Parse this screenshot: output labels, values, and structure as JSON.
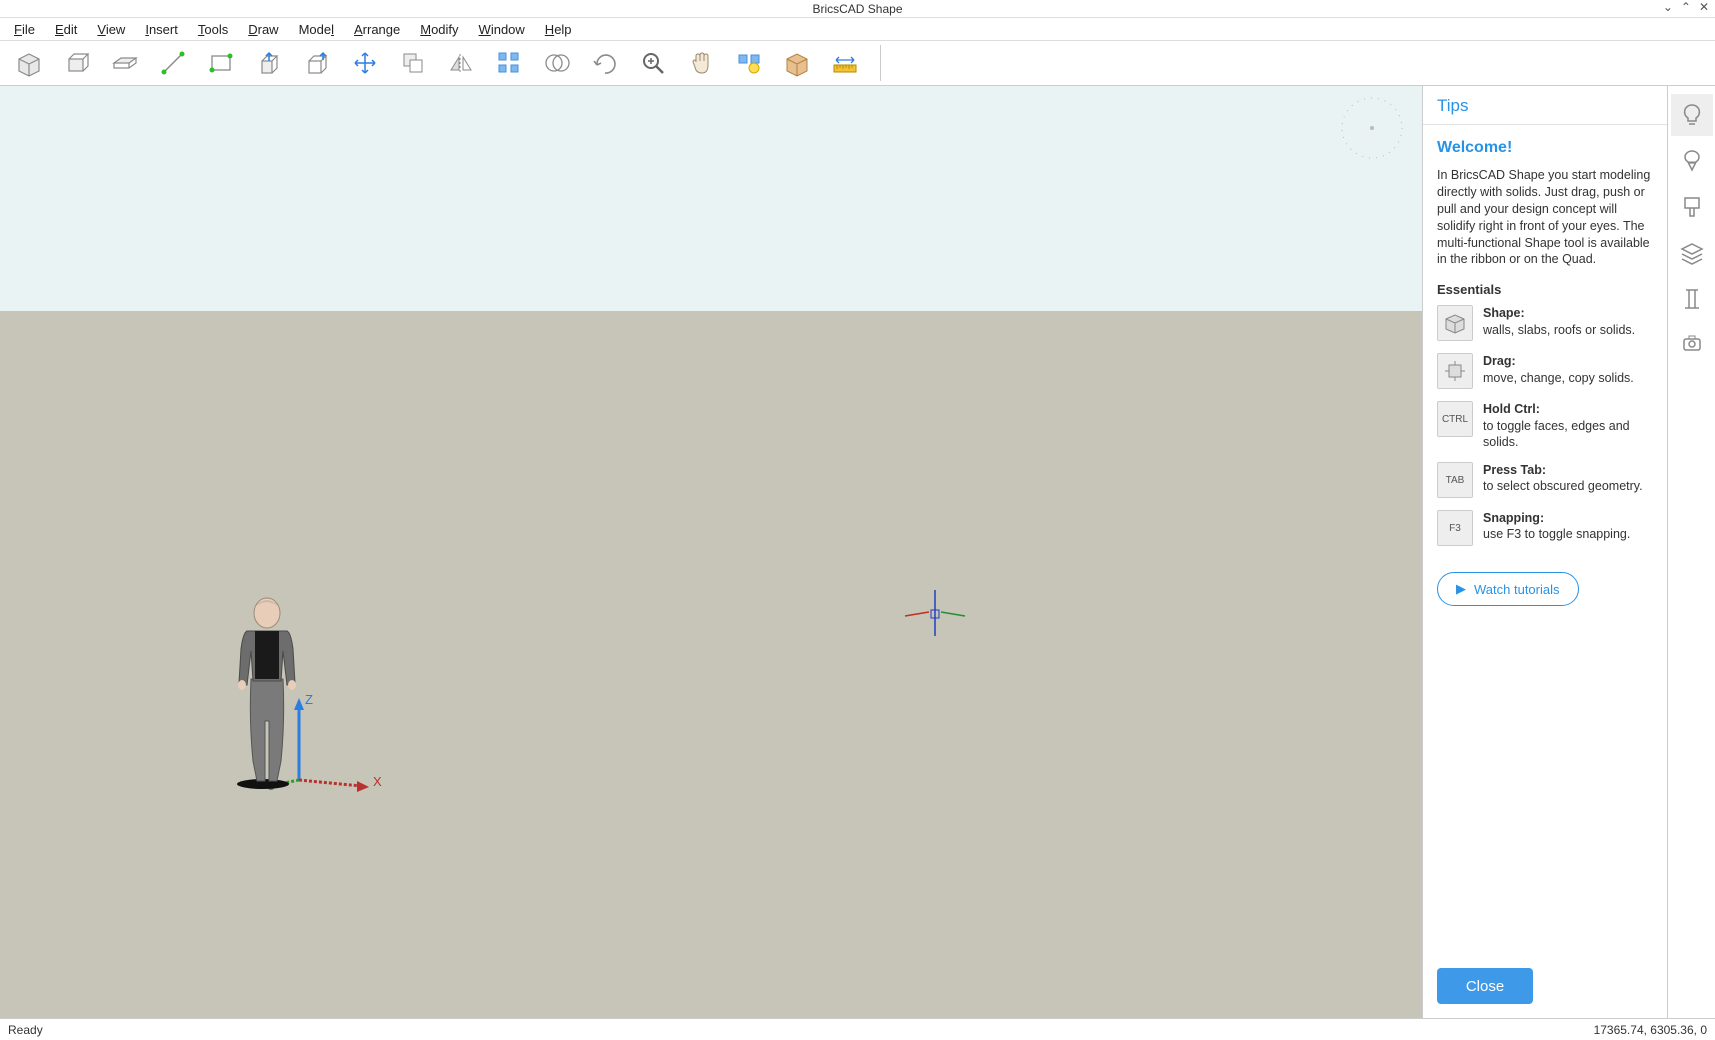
{
  "window": {
    "title": "BricsCAD Shape"
  },
  "menus": [
    "File",
    "Edit",
    "View",
    "Insert",
    "Tools",
    "Draw",
    "Model",
    "Arrange",
    "Modify",
    "Window",
    "Help"
  ],
  "toolbar_names": [
    "shape-tool",
    "box-tool",
    "slab-tool",
    "line-tool",
    "rect-tool",
    "pushpull-tool",
    "extrude-tool",
    "move-tool",
    "copy-tool",
    "mirror-tool",
    "array-tool",
    "boolean-tool",
    "rotate-tool",
    "zoom-tool",
    "pan-tool",
    "layers-tool",
    "materials-tool",
    "measure-tool"
  ],
  "tips": {
    "header": "Tips",
    "welcome": "Welcome!",
    "intro": "In BricsCAD Shape you start modeling directly with solids. Just drag, push or pull and your design concept will solidify right in front of your eyes. The multi-functional Shape tool is available in the ribbon or on the Quad.",
    "essentials_label": "Essentials",
    "items": [
      {
        "icon": "shape",
        "title": "Shape:",
        "desc": "walls, slabs, roofs or solids."
      },
      {
        "icon": "drag",
        "title": "Drag:",
        "desc": "move, change, copy solids."
      },
      {
        "icon": "CTRL",
        "title": "Hold Ctrl:",
        "desc": "to toggle faces, edges and solids."
      },
      {
        "icon": "TAB",
        "title": "Press Tab:",
        "desc": "to select obscured geometry."
      },
      {
        "icon": "F3",
        "title": "Snapping:",
        "desc": "use F3 to toggle snapping."
      }
    ],
    "watch": "Watch tutorials",
    "close": "Close"
  },
  "axes": {
    "x": "X",
    "z": "Z"
  },
  "status": {
    "left": "Ready",
    "right": "17365.74, 6305.36, 0"
  },
  "rail_names": [
    "tips-tab",
    "balloon-tab",
    "styles-tab",
    "layers-tab",
    "structure-tab",
    "render-tab"
  ]
}
